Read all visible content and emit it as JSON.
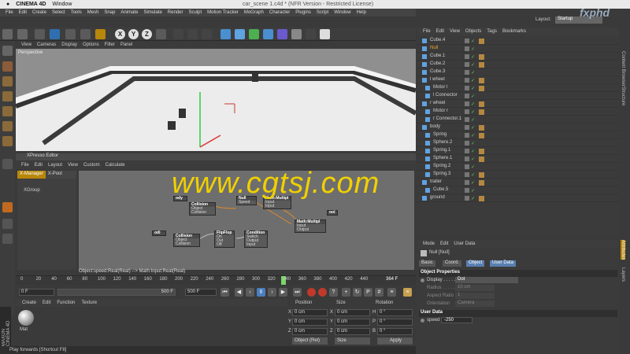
{
  "macbar": {
    "app": "CINEMA 4D",
    "window": "Window",
    "title": "car_scene 1.c4d * (NFR Version - Restricted License)"
  },
  "menu": [
    "File",
    "Edit",
    "Create",
    "Select",
    "Tools",
    "Mesh",
    "Snap",
    "Animate",
    "Simulate",
    "Render",
    "Sculpt",
    "Motion Tracker",
    "MoGraph",
    "Character",
    "Plugins",
    "Script",
    "Window",
    "Help"
  ],
  "layout": {
    "label": "Layout:",
    "value": "Startup"
  },
  "xyz": [
    "X",
    "Y",
    "Z"
  ],
  "viewport": {
    "menu": [
      "View",
      "Cameras",
      "Display",
      "Options",
      "Filter",
      "Panel"
    ],
    "label": "Perspective"
  },
  "xpresso": {
    "title": "XPresso Editor",
    "menu": [
      "File",
      "Edit",
      "Layout",
      "View",
      "Custom",
      "Calculate"
    ],
    "tabs": [
      "X-Manager",
      "X-Pool"
    ],
    "group": "XGroup",
    "nodes": {
      "n1": {
        "title": "Null",
        "port": "Speed"
      },
      "n2": {
        "title": "Math:Multipl",
        "ports": [
          "Input",
          "Input",
          "Output"
        ]
      },
      "n3": {
        "title": "Collision",
        "ports": [
          "Object",
          "Collision"
        ]
      },
      "n4": {
        "title": "Collision",
        "ports": [
          "Object",
          "Collision"
        ]
      },
      "n5": {
        "title": "FlipFlop",
        "ports": [
          "On",
          "Out",
          "Off"
        ]
      },
      "n6": {
        "title": "Condition",
        "ports": [
          "Switch",
          "Output",
          "Input"
        ]
      },
      "n7": {
        "title": "Math:Multipl",
        "ports": [
          "Input",
          "Output"
        ]
      },
      "n8": {
        "title": "ody",
        "port": ""
      },
      "n9": {
        "title": "ool",
        "port": ""
      }
    },
    "status": "Object:speed:Real(Real) --> Math:Input:Real(Real)"
  },
  "watermark": "www.cgtsj.com",
  "timeline": {
    "ticks": [
      "0",
      "20",
      "40",
      "60",
      "80",
      "100",
      "120",
      "140",
      "160",
      "180",
      "200",
      "220",
      "240",
      "260",
      "280",
      "300",
      "320",
      "340",
      "360",
      "380",
      "400",
      "420",
      "440"
    ],
    "frame": "364 F",
    "current": "0 F",
    "end": "500 F",
    "range_end": "500 F"
  },
  "material": {
    "menu": [
      "Create",
      "Edit",
      "Function",
      "Texture"
    ],
    "name": "Mat"
  },
  "coords": {
    "headers": [
      "Position",
      "Size",
      "Rotation"
    ],
    "rows": [
      {
        "axis": "X",
        "pos": "0 cm",
        "size": "0 cm",
        "rl": "H",
        "rot": "0 °"
      },
      {
        "axis": "Y",
        "pos": "0 cm",
        "size": "0 cm",
        "rl": "P",
        "rot": "0 °"
      },
      {
        "axis": "Z",
        "pos": "0 cm",
        "size": "0 cm",
        "rl": "B",
        "rot": "0 °"
      }
    ],
    "mode": "Object (Rel)",
    "sizemode": "Size",
    "apply": "Apply"
  },
  "statusbar": "Play forwards [Shortcut F8]",
  "objects": {
    "menu": [
      "File",
      "Edit",
      "View",
      "Objects",
      "Tags",
      "Bookmarks"
    ],
    "items": [
      "Cube.4",
      "Null",
      "Cube.1",
      "Cube.2",
      "Cube.3",
      "l wheel",
      "Motor l",
      "l Connector",
      "r wheel",
      "Motor r",
      "r Connector.1",
      "body",
      "Spring",
      "Sphere.2",
      "Spring.1",
      "Sphere.1",
      "Spring.2",
      "Spring.3",
      "trailer",
      "Cube.5",
      "ground"
    ]
  },
  "attributes": {
    "menu": [
      "Mode",
      "Edit",
      "User Data"
    ],
    "object": "Null [Null]",
    "tabs": [
      "Basic",
      "Coord.",
      "Object",
      "User Data"
    ],
    "section1": "Object Properties",
    "props": [
      {
        "label": "Display . . . . .",
        "value": "Dot"
      },
      {
        "label": "Radius . . . . .",
        "value": "10 cm"
      },
      {
        "label": "Aspect Ratio",
        "value": "1"
      },
      {
        "label": "Orientation",
        "value": "Camera"
      }
    ],
    "section2": "User Data",
    "speed": {
      "label": "speed",
      "value": "-250"
    }
  },
  "sidebar_right": [
    "Content Browser",
    "Structure",
    "Attributes",
    "Layers"
  ],
  "logo": "MAXON CINEMA 4D",
  "corner_brand": "fxphd"
}
